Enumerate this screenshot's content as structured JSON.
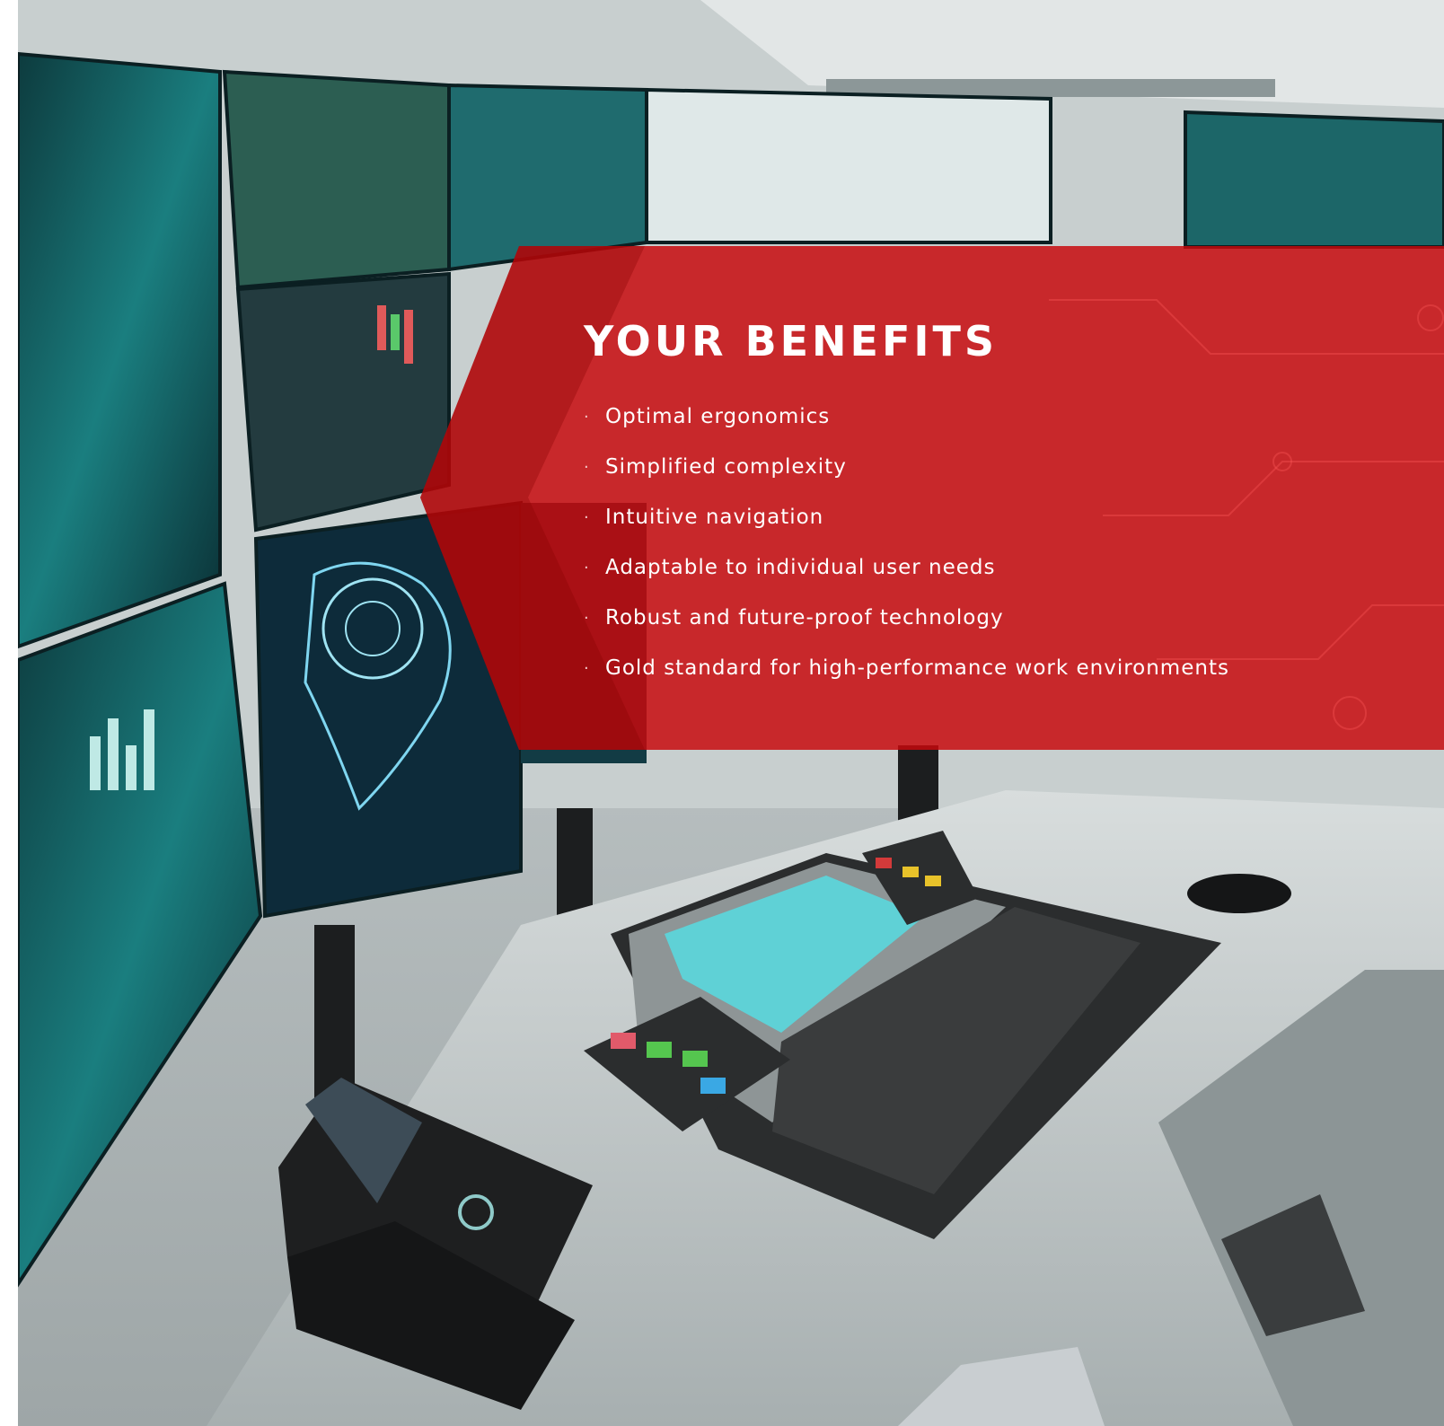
{
  "banner": {
    "title": "YOUR BENEFITS",
    "bullet": "·",
    "items": [
      "Optimal ergonomics",
      "Simplified complexity",
      "Intuitive navigation",
      "Adaptable to individual user needs",
      "Robust and future-proof technology",
      "Gold standard for high-performance work environments"
    ],
    "color": "#c8080c"
  },
  "photo": {
    "subject": "control-room-workstation",
    "icons": [
      "video-wall-icon",
      "keyboard-icon",
      "desk-phone-icon",
      "mouse-icon",
      "smartphone-icon",
      "world-map-icon"
    ]
  }
}
